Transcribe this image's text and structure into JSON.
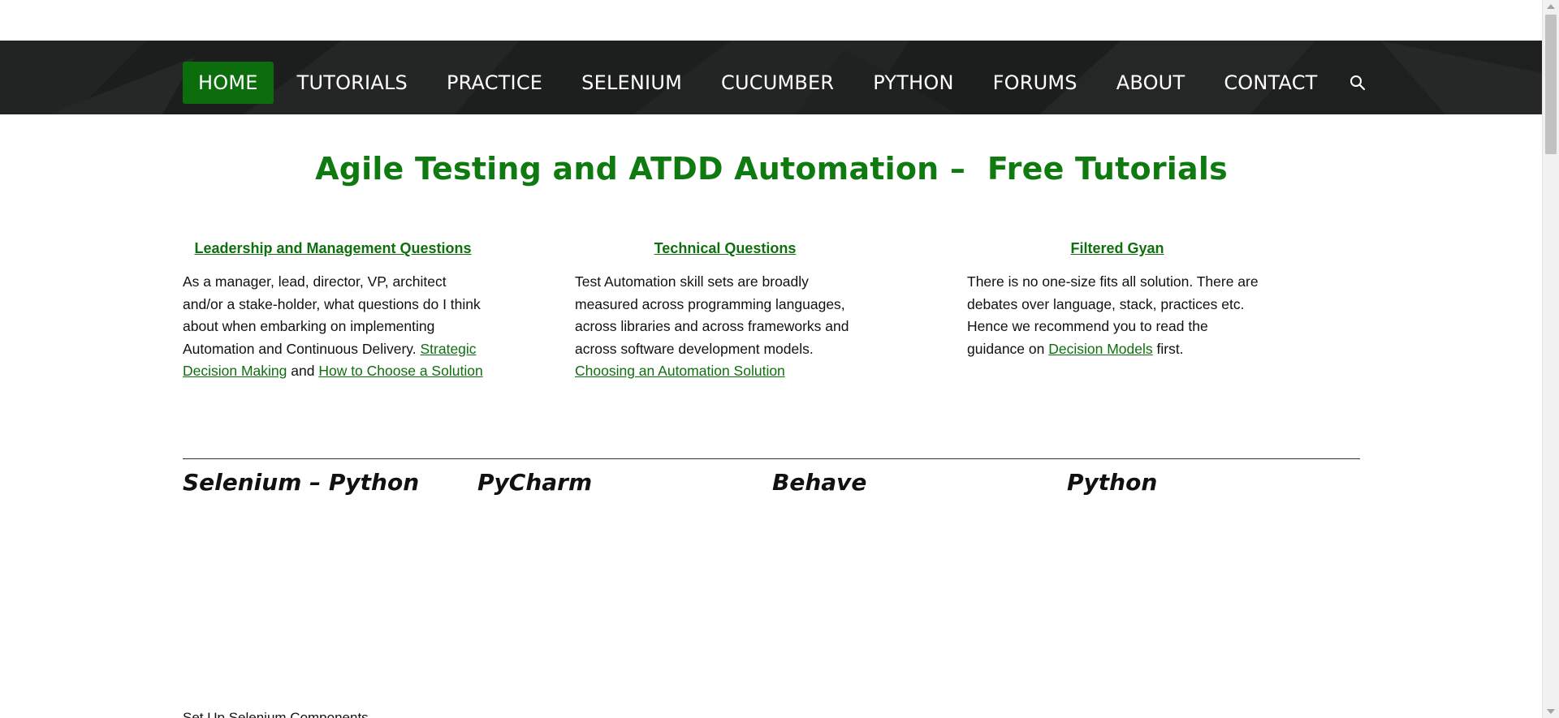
{
  "nav": {
    "items": [
      {
        "label": "HOME",
        "active": true
      },
      {
        "label": "TUTORIALS",
        "active": false
      },
      {
        "label": "PRACTICE",
        "active": false
      },
      {
        "label": "SELENIUM",
        "active": false
      },
      {
        "label": "CUCUMBER",
        "active": false
      },
      {
        "label": "PYTHON",
        "active": false
      },
      {
        "label": "FORUMS",
        "active": false
      },
      {
        "label": "ABOUT",
        "active": false
      },
      {
        "label": "CONTACT",
        "active": false
      }
    ],
    "search_icon": "search-icon",
    "active_color": "#0b6d0b",
    "background_color": "#1f2020"
  },
  "page": {
    "title": "Agile Testing and ATDD Automation –  Free Tutorials",
    "title_color": "#0f7a0f"
  },
  "columns": [
    {
      "heading": "Leadership and Management Questions",
      "text": "As a manager, lead, director, VP, architect and/or a stake-holder, what questions do I think about when embarking on implementing Automation and Continuous Delivery. ",
      "link1": "Strategic Decision Making",
      "middle": " and ",
      "link2": "How to Choose a Solution",
      "tail": ""
    },
    {
      "heading": "Technical Questions",
      "text": "Test Automation skill sets are broadly measured across programming languages, across libraries and across frameworks and across software development models. ",
      "link1": "Choosing an Automation Solution",
      "tail": ""
    },
    {
      "heading": "Filtered Gyan",
      "text": "There is no one-size fits all solution. There are debates over language, stack, practices etc. Hence we recommend you to read the guidance on ",
      "link1": "Decision Models",
      "tail": " first."
    }
  ],
  "topics": [
    "Selenium – Python",
    "PyCharm",
    "Behave",
    "Python"
  ],
  "footer_cut_text": "Set Up Selenium Components"
}
